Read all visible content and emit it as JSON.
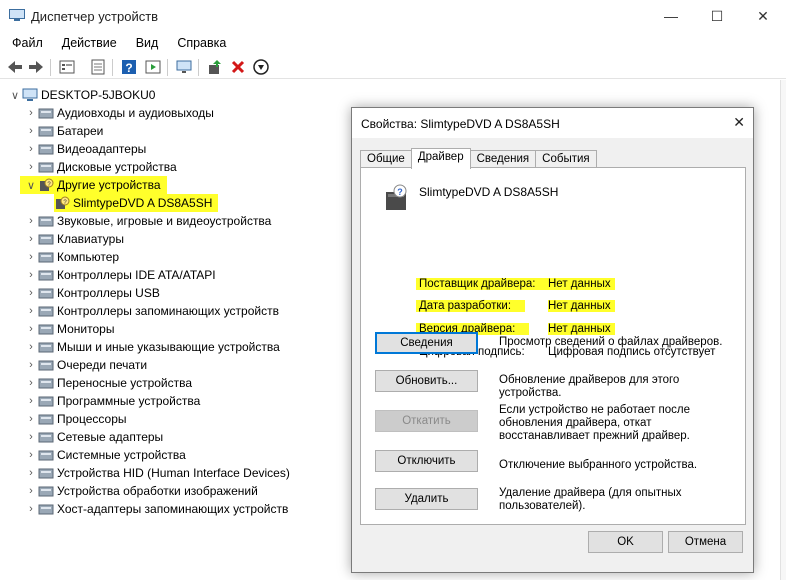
{
  "window": {
    "title": "Диспетчер устройств"
  },
  "menu": [
    "Файл",
    "Действие",
    "Вид",
    "Справка"
  ],
  "tree": {
    "root": "DESKTOP-5JBOKU0",
    "items": [
      {
        "label": "Аудиовходы и аудиовыходы",
        "icon": "speaker-icon"
      },
      {
        "label": "Батареи",
        "icon": "battery-icon"
      },
      {
        "label": "Видеоадаптеры",
        "icon": "display-adapter-icon"
      },
      {
        "label": "Дисковые устройства",
        "icon": "disk-drive-icon"
      },
      {
        "label": "Другие устройства",
        "icon": "unknown-device-icon",
        "expanded": true,
        "highlight": true
      },
      {
        "label": "SlimtypeDVD A  DS8A5SH",
        "icon": "unknown-device-icon",
        "child": true,
        "highlight": true
      },
      {
        "label": "Звуковые, игровые и видеоустройства",
        "icon": "speaker-icon"
      },
      {
        "label": "Клавиатуры",
        "icon": "keyboard-icon"
      },
      {
        "label": "Компьютер",
        "icon": "monitor-icon"
      },
      {
        "label": "Контроллеры IDE ATA/ATAPI",
        "icon": "controller-icon"
      },
      {
        "label": "Контроллеры USB",
        "icon": "usb-icon"
      },
      {
        "label": "Контроллеры запоминающих устройств",
        "icon": "storage-controller-icon"
      },
      {
        "label": "Мониторы",
        "icon": "monitor-icon"
      },
      {
        "label": "Мыши и иные указывающие устройства",
        "icon": "mouse-icon"
      },
      {
        "label": "Очереди печати",
        "icon": "printer-icon"
      },
      {
        "label": "Переносные устройства",
        "icon": "portable-device-icon"
      },
      {
        "label": "Программные устройства",
        "icon": "software-device-icon"
      },
      {
        "label": "Процессоры",
        "icon": "cpu-icon"
      },
      {
        "label": "Сетевые адаптеры",
        "icon": "network-icon"
      },
      {
        "label": "Системные устройства",
        "icon": "system-device-icon"
      },
      {
        "label": "Устройства HID (Human Interface Devices)",
        "icon": "hid-icon"
      },
      {
        "label": "Устройства обработки изображений",
        "icon": "camera-icon"
      },
      {
        "label": "Хост-адаптеры запоминающих устройств",
        "icon": "storage-controller-icon"
      }
    ]
  },
  "dialog": {
    "title": "Свойства: SlimtypeDVD A  DS8A5SH",
    "tabs": [
      "Общие",
      "Драйвер",
      "Сведения",
      "События"
    ],
    "active_tab": "Драйвер",
    "device_name": "SlimtypeDVD A  DS8A5SH",
    "properties": [
      {
        "label": "Поставщик драйвера:",
        "value": "Нет данных",
        "highlight": true
      },
      {
        "label": "Дата разработки:",
        "value": "Нет данных",
        "highlight": true
      },
      {
        "label": "Версия драйвера:",
        "value": "Нет данных",
        "highlight": true
      },
      {
        "label": "Цифровая подпись:",
        "value": "Цифровая подпись отсутствует",
        "highlight": false
      }
    ],
    "actions": [
      {
        "button": "Сведения",
        "desc": "Просмотр сведений о файлах драйверов.",
        "state": "default"
      },
      {
        "button": "Обновить...",
        "desc": "Обновление драйверов для этого устройства.",
        "state": "normal"
      },
      {
        "button": "Откатить",
        "desc": "Если устройство не работает после обновления драйвера, откат восстанавливает прежний драйвер.",
        "state": "disabled"
      },
      {
        "button": "Отключить",
        "desc": "Отключение выбранного устройства.",
        "state": "normal"
      },
      {
        "button": "Удалить",
        "desc": "Удаление драйвера (для опытных пользователей).",
        "state": "normal"
      }
    ],
    "ok": "OK",
    "cancel": "Отмена"
  },
  "colors": {
    "highlight": "#ffff2b",
    "accent": "#0078d7"
  }
}
